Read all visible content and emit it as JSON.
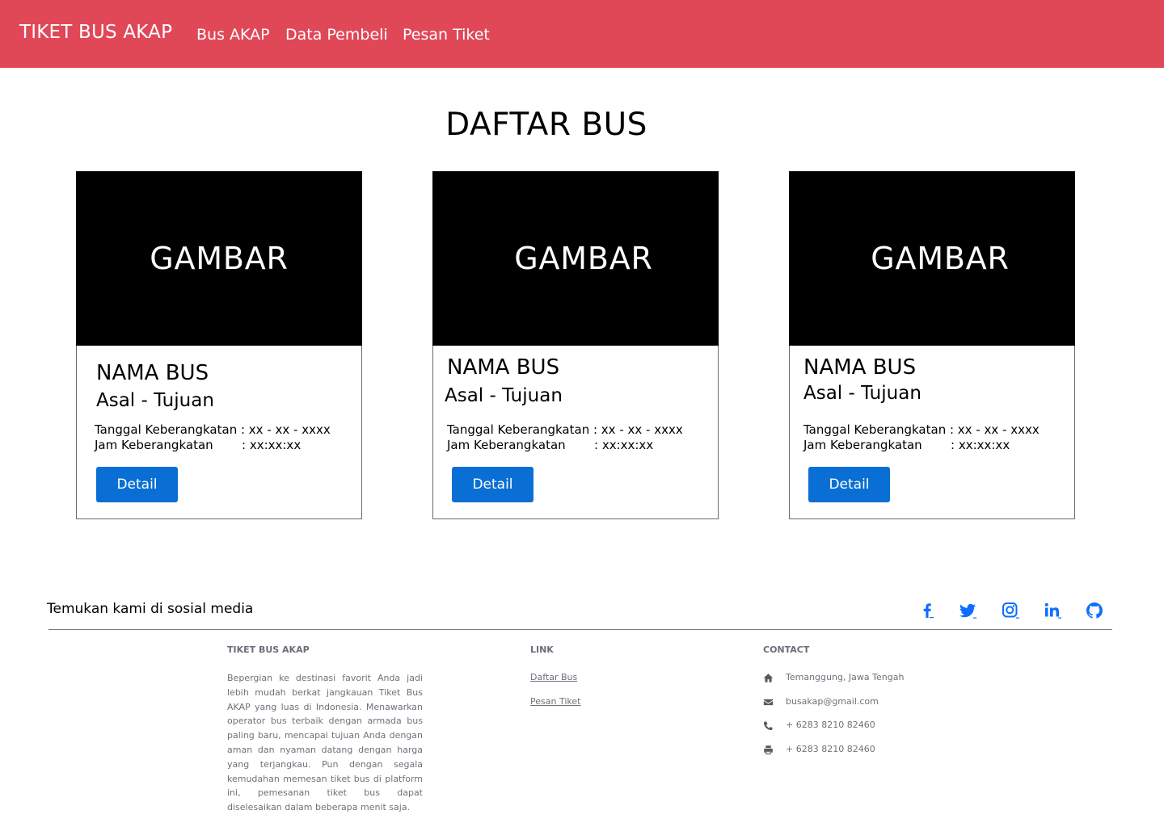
{
  "navbar": {
    "brand": "TIKET BUS AKAP",
    "links": [
      "Bus AKAP",
      "Data Pembeli",
      "Pesan Tiket"
    ]
  },
  "main": {
    "title": "DAFTAR BUS",
    "cards": [
      {
        "image_label": "GAMBAR",
        "bus_name": "NAMA BUS",
        "route": "Asal - Tujuan",
        "departure_date_label": "Tanggal Keberangkatan",
        "departure_date_value": ": xx - xx - xxxx",
        "departure_time_label": "Jam Keberangkatan",
        "departure_time_value": ": xx:xx:xx",
        "button_label": "Detail"
      },
      {
        "image_label": "GAMBAR",
        "bus_name": "NAMA BUS",
        "route": "Asal - Tujuan",
        "departure_date_label": "Tanggal Keberangkatan",
        "departure_date_value": ": xx - xx - xxxx",
        "departure_time_label": "Jam Keberangkatan",
        "departure_time_value": ": xx:xx:xx",
        "button_label": "Detail"
      },
      {
        "image_label": "GAMBAR",
        "bus_name": "NAMA BUS",
        "route": "Asal - Tujuan",
        "departure_date_label": "Tanggal Keberangkatan",
        "departure_date_value": ": xx - xx - xxxx",
        "departure_time_label": "Jam Keberangkatan",
        "departure_time_value": ": xx:xx:xx",
        "button_label": "Detail"
      }
    ]
  },
  "social": {
    "text": "Temukan kami di sosial media",
    "icons": [
      "facebook-icon",
      "twitter-icon",
      "instagram-icon",
      "linkedin-icon",
      "github-icon"
    ],
    "icon_color": "#0d6efd"
  },
  "footer": {
    "about": {
      "heading": "TIKET BUS AKAP",
      "text": "Bepergian ke destinasi favorit Anda jadi lebih mudah berkat jangkauan Tiket Bus AKAP yang luas di Indonesia. Menawarkan operator bus terbaik dengan armada bus paling baru, mencapai tujuan Anda dengan aman dan nyaman datang dengan harga yang terjangkau. Pun dengan segala kemudahan memesan tiket bus di platform ini, pemesanan tiket bus dapat diselesaikan dalam beberapa menit saja."
    },
    "links": {
      "heading": "LINK",
      "items": [
        "Daftar Bus",
        "Pesan Tiket"
      ]
    },
    "contact": {
      "heading": "CONTACT",
      "address": "Temanggung, Jawa Tengah",
      "email": "busakap@gmail.com",
      "phone": "+ 6283 8210 82460",
      "fax": "+ 6283 8210 82460"
    }
  },
  "colors": {
    "navbar": "#e04858",
    "button": "#0a6fd4"
  }
}
